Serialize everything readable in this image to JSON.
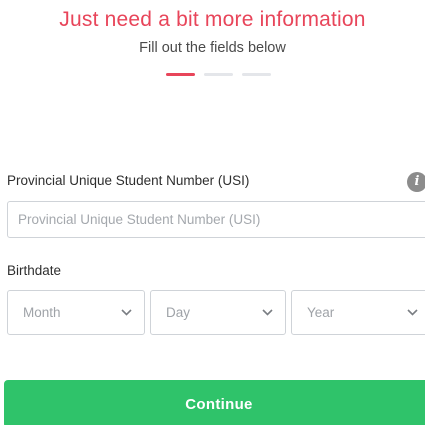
{
  "header": {
    "title": "Just need a bit more information",
    "subtitle": "Fill out the fields below"
  },
  "progress": {
    "total_steps": 3,
    "current_step": 1
  },
  "usi": {
    "label": "Provincial Unique Student Number (USI)",
    "placeholder": "Provincial Unique Student Number (USI)",
    "value": "",
    "info_icon": "info-icon"
  },
  "birthdate": {
    "label": "Birthdate",
    "month": "Month",
    "day": "Day",
    "year": "Year",
    "chevron_icon": "chevron-down-icon"
  },
  "actions": {
    "continue_label": "Continue"
  },
  "colors": {
    "accent": "#e8455a",
    "button": "#2fc36a"
  }
}
